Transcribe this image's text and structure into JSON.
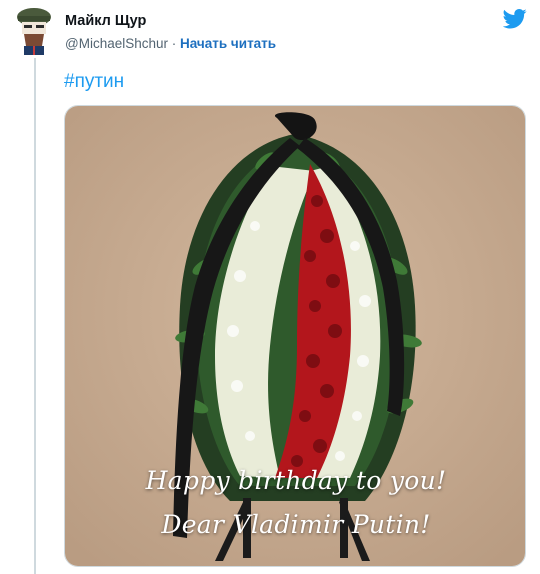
{
  "tweet": {
    "author_name": "Майкл Щур",
    "handle": "@MichaelShchur",
    "separator": " · ",
    "follow_label": "Начать читать",
    "hashtag": "#путин"
  },
  "image_caption": {
    "line1": "Happy birthday to you!",
    "line2": "Dear Vladimir Putin!"
  },
  "colors": {
    "brand_blue": "#1d9bf0",
    "follow_blue": "#1d6fbf",
    "background_beige": "#c7ab91"
  },
  "icons": {
    "brand": "twitter-bird-icon"
  }
}
